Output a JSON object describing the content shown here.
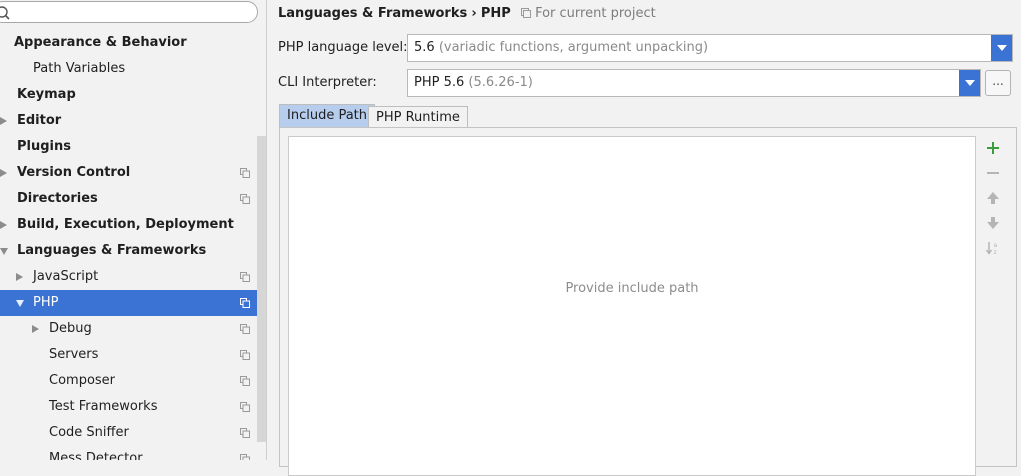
{
  "search": {
    "value": "",
    "placeholder": ""
  },
  "tree": [
    {
      "label": "Appearance & Behavior",
      "bold": true,
      "arrow": "none",
      "indent": 0,
      "scope_icon": false
    },
    {
      "label": "Path Variables",
      "bold": false,
      "arrow": "none",
      "indent": 1,
      "scope_icon": false
    },
    {
      "label": "Keymap",
      "bold": true,
      "arrow": "none",
      "indent": 0,
      "scope_icon": false
    },
    {
      "label": "Editor",
      "bold": true,
      "arrow": "right",
      "indent": 0,
      "scope_icon": false
    },
    {
      "label": "Plugins",
      "bold": true,
      "arrow": "none",
      "indent": 0,
      "scope_icon": false
    },
    {
      "label": "Version Control",
      "bold": true,
      "arrow": "right",
      "indent": 0,
      "scope_icon": true
    },
    {
      "label": "Directories",
      "bold": true,
      "arrow": "none",
      "indent": 0,
      "scope_icon": true
    },
    {
      "label": "Build, Execution, Deployment",
      "bold": true,
      "arrow": "right",
      "indent": 0,
      "scope_icon": false
    },
    {
      "label": "Languages & Frameworks",
      "bold": true,
      "arrow": "down",
      "indent": 0,
      "scope_icon": false
    },
    {
      "label": "JavaScript",
      "bold": false,
      "arrow": "right",
      "indent": 1,
      "scope_icon": true
    },
    {
      "label": "PHP",
      "bold": false,
      "arrow": "down",
      "indent": 1,
      "scope_icon": true,
      "selected": true
    },
    {
      "label": "Debug",
      "bold": false,
      "arrow": "right",
      "indent": 2,
      "scope_icon": true
    },
    {
      "label": "Servers",
      "bold": false,
      "arrow": "none",
      "indent": 2,
      "scope_icon": true
    },
    {
      "label": "Composer",
      "bold": false,
      "arrow": "none",
      "indent": 2,
      "scope_icon": true
    },
    {
      "label": "Test Frameworks",
      "bold": false,
      "arrow": "none",
      "indent": 2,
      "scope_icon": true
    },
    {
      "label": "Code Sniffer",
      "bold": false,
      "arrow": "none",
      "indent": 2,
      "scope_icon": true
    },
    {
      "label": "Mess Detector",
      "bold": false,
      "arrow": "none",
      "indent": 2,
      "scope_icon": true
    }
  ],
  "breadcrumb": {
    "parent": "Languages & Frameworks",
    "separator": "›",
    "current": "PHP",
    "scope": "For current project"
  },
  "language_level": {
    "label": "PHP language level:",
    "value": "5.6",
    "detail": "(variadic functions, argument unpacking)"
  },
  "cli_interpreter": {
    "label": "CLI Interpreter:",
    "value": "PHP 5.6",
    "detail": "(5.6.26-1)",
    "browse_label": "..."
  },
  "tabs": [
    {
      "label": "Include Path",
      "active": true
    },
    {
      "label": "PHP Runtime",
      "active": false
    }
  ],
  "include_path": {
    "empty_text": "Provide include path",
    "toolbar": [
      "add-icon",
      "remove-icon",
      "move-up-icon",
      "move-down-icon",
      "sort-icon"
    ]
  },
  "colors": {
    "selection": "#3b73d4",
    "active_tab": "#b6cdee",
    "add_icon": "#3c9b3c",
    "disabled_icon": "#b5b5b5"
  }
}
